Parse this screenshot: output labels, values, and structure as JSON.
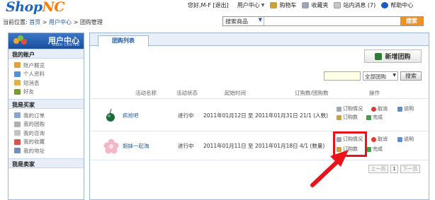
{
  "header": {
    "logo_main": "Shop",
    "logo_accent": "NC",
    "greeting": "您好,M-F [退出]",
    "links": [
      "用户中心",
      "购物车",
      "收藏夹",
      "站内消息 (7)",
      "帮助中心"
    ]
  },
  "breadcrumb": {
    "prefix": "当前位置:",
    "items": [
      "首页",
      "用户中心",
      "团购管理"
    ],
    "separator": ">"
  },
  "search": {
    "category": "搜索商品",
    "button": "搜索"
  },
  "sidebar": {
    "title": "用户中心",
    "subtitle": "USER CENTER",
    "sections": [
      {
        "title": "我的账户",
        "items": [
          "账户概览",
          "个人资料",
          "短消息",
          "好友"
        ]
      },
      {
        "title": "我是买家",
        "items": [
          "我的订单",
          "我的团购",
          "我的咨询",
          "我的收藏",
          "我的地址"
        ]
      },
      {
        "title": "我是卖家",
        "items": []
      }
    ]
  },
  "main": {
    "tab": "团购列表",
    "new_button": "新增团购",
    "filter": {
      "select": "全部团购",
      "button": "搜索"
    },
    "columns": [
      "活动名称",
      "活动状态",
      "起始时间",
      "订购数/团购数",
      "操作"
    ],
    "rows": [
      {
        "name": "疯抢吧",
        "status": "进行中",
        "time": "2011年01月12日 至 2011年01月31日",
        "count": "21/1 (人数)",
        "ops": [
          "订购情况",
          "取消",
          "说明",
          "订购数",
          "完成"
        ]
      },
      {
        "name": "姐妹一起淘",
        "status": "进行中",
        "time": "2011年01月11日 至 2011年01月18日",
        "count": "4/1 (数量)",
        "ops": [
          "订购情况",
          "取消",
          "说明",
          "订购数",
          "完成"
        ]
      }
    ],
    "pager": {
      "prev": "上一页",
      "current": "1",
      "next": "下一页"
    }
  },
  "colors": {
    "brand_blue": "#1a66c0",
    "brand_orange": "#ff7a00",
    "search_button": "#f39020",
    "annotation_red": "#e8131b"
  }
}
